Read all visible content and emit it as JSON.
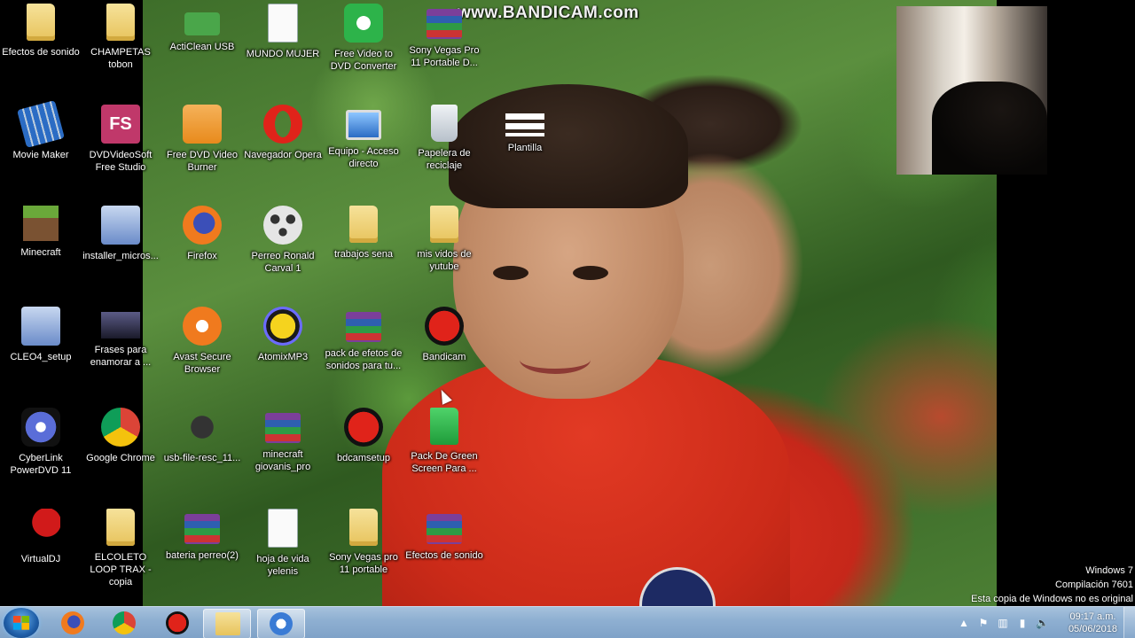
{
  "watermark": "www.BANDICAM.com",
  "desktop_icons": [
    {
      "label": "Efectos de sonido",
      "icon": "folder-icon",
      "color": "#e7c35c"
    },
    {
      "label": "CHAMPETAS tobon",
      "icon": "folder-icon",
      "color": "#e7c35c"
    },
    {
      "label": "ActiClean USB",
      "icon": "usb-icon",
      "color": "#4aa64a"
    },
    {
      "label": "MUNDO MUJER",
      "icon": "spreadsheet-icon",
      "color": "#2e8b3e"
    },
    {
      "label": "Free Video to DVD Converter",
      "icon": "dvd-converter-icon",
      "color": "#2db34a"
    },
    {
      "label": "Sony Vegas Pro 11 Portable D...",
      "icon": "winrar-icon",
      "color": "#7b3f9a"
    },
    {
      "label": "Movie Maker",
      "icon": "movie-maker-icon",
      "color": "#2b6cc4"
    },
    {
      "label": "DVDVideoSoft Free Studio",
      "icon": "fs-icon",
      "color": "#c0386a"
    },
    {
      "label": "Free DVD Video Burner",
      "icon": "dvd-burner-icon",
      "color": "#e88a1c"
    },
    {
      "label": "Navegador Opera",
      "icon": "opera-icon",
      "color": "#e0231a"
    },
    {
      "label": "Equipo - Acceso directo",
      "icon": "computer-icon",
      "color": "#3c7fd1"
    },
    {
      "label": "Papelera de reciclaje",
      "icon": "recycle-bin-icon",
      "color": "#d9dde2"
    },
    {
      "label": "Plantilla",
      "icon": "template-icon",
      "color": "#ffffff"
    },
    {
      "label": "Minecraft",
      "icon": "minecraft-icon",
      "color": "#5b8a2e"
    },
    {
      "label": "installer_micros...",
      "icon": "installer-icon",
      "color": "#6a8bc9"
    },
    {
      "label": "Firefox",
      "icon": "firefox-icon",
      "color": "#f07a1e"
    },
    {
      "label": "Perreo Ronald Carval 1",
      "icon": "media-icon",
      "color": "#e5e5e5"
    },
    {
      "label": "trabajos sena",
      "icon": "folder-icon",
      "color": "#e7c35c"
    },
    {
      "label": "mis vidos de yutube",
      "icon": "folder-icon",
      "color": "#e7c35c"
    },
    {
      "label": "CLEO4_setup",
      "icon": "setup-icon",
      "color": "#6a8bc9"
    },
    {
      "label": "Frases para enamorar a ...",
      "icon": "video-thumbnail-icon",
      "color": "#3a3a5a"
    },
    {
      "label": "Avast Secure Browser",
      "icon": "avast-icon",
      "color": "#f07a1e"
    },
    {
      "label": "AtomixMP3",
      "icon": "atomix-icon",
      "color": "#f5d31e"
    },
    {
      "label": "pack de efetos de sonidos para tu...",
      "icon": "winrar-icon",
      "color": "#7b3f9a"
    },
    {
      "label": "Bandicam",
      "icon": "bandicam-icon",
      "color": "#e0231a"
    },
    {
      "label": "CyberLink PowerDVD 11",
      "icon": "powerdvd-icon",
      "color": "#5a6dd8"
    },
    {
      "label": "Google Chrome",
      "icon": "chrome-icon",
      "color": "#db4437"
    },
    {
      "label": "usb-file-resc_11...",
      "icon": "usb-rescue-icon",
      "color": "#333333"
    },
    {
      "label": "minecraft giovanis_pro",
      "icon": "winrar-icon",
      "color": "#7b3f9a"
    },
    {
      "label": "bdcamsetup",
      "icon": "bdcamsetup-icon",
      "color": "#e0231a"
    },
    {
      "label": "Pack De Green Screen Para ...",
      "icon": "green-folder-icon",
      "color": "#2bb34a"
    },
    {
      "label": "VirtualDJ",
      "icon": "virtualdj-icon",
      "color": "#d11a1a"
    },
    {
      "label": "ELCOLETO LOOP TRAX - copia",
      "icon": "folder-icon",
      "color": "#e7c35c"
    },
    {
      "label": "bateria perreo(2)",
      "icon": "winrar-icon",
      "color": "#7b3f9a"
    },
    {
      "label": "hoja de vida yelenis",
      "icon": "document-icon",
      "color": "#2b6cc4"
    },
    {
      "label": "Sony Vegas pro 11 portable",
      "icon": "folder-icon",
      "color": "#e7c35c"
    },
    {
      "label": "Efectos de sonido",
      "icon": "winrar-icon",
      "color": "#7b3f9a"
    }
  ],
  "activation": {
    "line1": "Windows 7",
    "line2": "Compilación 7601",
    "line3": "Esta copia de Windows no es original"
  },
  "taskbar": {
    "pinned": [
      {
        "name": "firefox",
        "icon": "firefox-icon",
        "color": "#f07a1e"
      },
      {
        "name": "chrome",
        "icon": "chrome-icon",
        "color": "#db4437"
      },
      {
        "name": "bandicam",
        "icon": "bandicam-icon",
        "color": "#e0231a"
      },
      {
        "name": "explorer",
        "icon": "explorer-icon",
        "color": "#e7c35c"
      },
      {
        "name": "chrome-window",
        "icon": "chrome-icon",
        "color": "#3a7bd5"
      }
    ],
    "clock": {
      "time": "09:17 a.m.",
      "date": "05/06/2018"
    }
  }
}
